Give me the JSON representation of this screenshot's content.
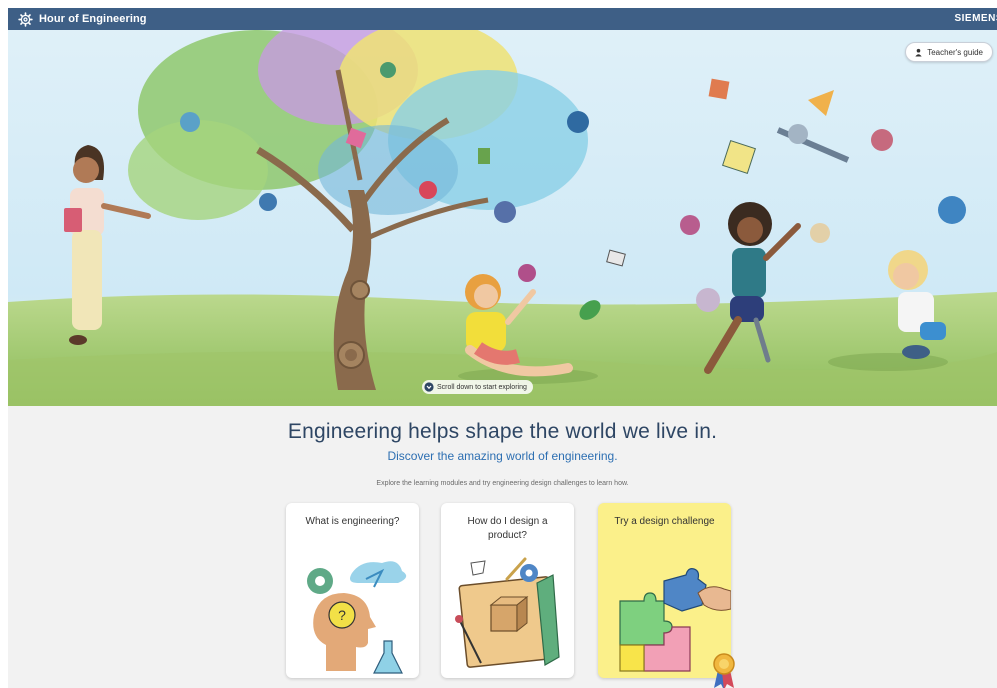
{
  "topbar": {
    "brand_title": "Hour of Engineering",
    "brand_icon": "gear-icon",
    "company": "SIEMENS"
  },
  "hero": {
    "teacher_button": "Teacher's guide",
    "teacher_icon": "person-icon",
    "scroll_hint": "Scroll down to start exploring",
    "scroll_icon": "chevron-down-icon"
  },
  "intro": {
    "headline": "Engineering helps shape the world we live in.",
    "subline": "Discover the amazing world of engineering.",
    "explore": "Explore the learning modules and try engineering design challenges to learn how."
  },
  "cards": [
    {
      "title": "What is engineering?",
      "icon": "thinking-head-icon"
    },
    {
      "title": "How do I design a product?",
      "icon": "blueprint-icon"
    },
    {
      "title": "Try a design challenge",
      "icon": "puzzle-icon"
    }
  ],
  "colors": {
    "topbar": "#3e5f86",
    "headline": "#2e4664",
    "subline": "#2d6fb2",
    "challenge_card": "#fbf08a"
  }
}
